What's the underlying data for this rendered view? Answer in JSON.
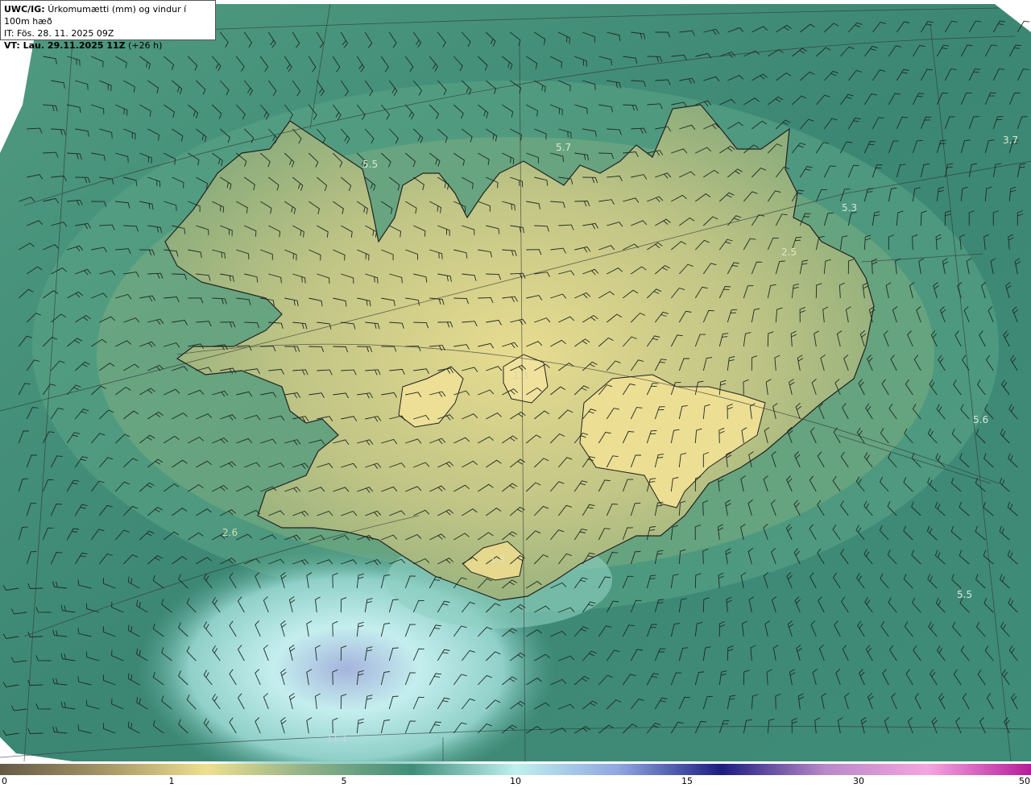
{
  "info": {
    "model_prefix": "UWC/IG:",
    "title": "Úrkomumætti (mm) og vindur í 100m hæð",
    "issue_time": "IT: Fös. 28. 11. 2025 09Z",
    "valid_prefix": "VT: Lau. 29.11.2025 11Z",
    "valid_offset": "(+26 h)"
  },
  "map_values": [
    "5.5",
    "5.7",
    "3.7",
    "5.3",
    "2.5",
    "1.3",
    "1.8",
    "2.6",
    "5.6",
    "5.5",
    "11.1"
  ],
  "legend": {
    "ticks": [
      "0",
      "1",
      "5",
      "10",
      "15",
      "30",
      "50"
    ],
    "colors": [
      "#665a48",
      "#a39565",
      "#eedf8f",
      "#8fb087",
      "#3f8e7a",
      "#bff0ee",
      "#90a6e0",
      "#1c1d80",
      "#b888c8",
      "#f5a5df",
      "#b51c9a"
    ]
  },
  "colors": {
    "sea": "#3d8874",
    "land_low": "#9bb27a",
    "land_high": "#e2d68c",
    "heavy": "#c4eeee",
    "very_heavy": "#a5b4dd"
  }
}
